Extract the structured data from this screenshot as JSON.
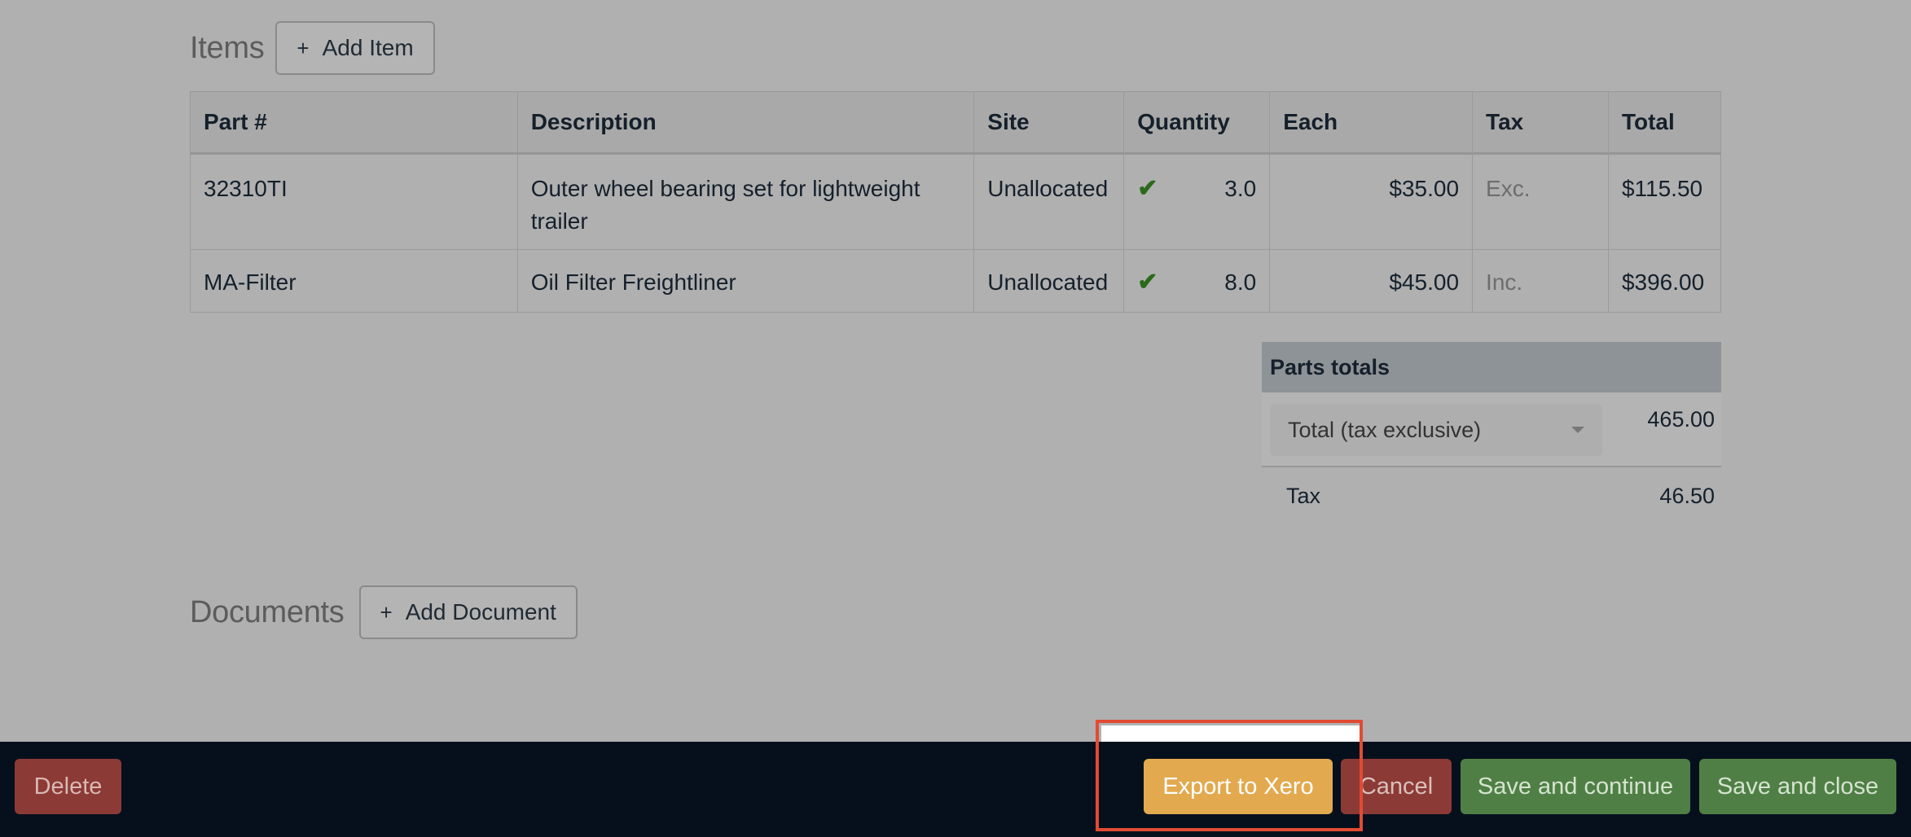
{
  "items_section": {
    "title": "Items",
    "add_button": "Add Item",
    "plus_glyph": "+"
  },
  "items_table": {
    "headers": [
      "Part #",
      "Description",
      "Site",
      "Quantity",
      "Each",
      "Tax",
      "Total"
    ],
    "rows": [
      {
        "part": "32310TI",
        "description": "Outer wheel bearing set for lightweight trailer",
        "site": "Unallocated",
        "allocated_check": "✔",
        "quantity": "3.0",
        "each": "$35.00",
        "tax": "Exc.",
        "total": "$115.50"
      },
      {
        "part": "MA-Filter",
        "description": "Oil Filter Freightliner",
        "site": "Unallocated",
        "allocated_check": "✔",
        "quantity": "8.0",
        "each": "$45.00",
        "tax": "Inc.",
        "total": "$396.00"
      }
    ]
  },
  "parts_totals": {
    "title": "Parts totals",
    "total_mode_selected": "Total (tax exclusive)",
    "total_value": "465.00",
    "tax_label": "Tax",
    "tax_value": "46.50"
  },
  "documents_section": {
    "title": "Documents",
    "add_button": "Add Document",
    "plus_glyph": "+"
  },
  "footer": {
    "delete": "Delete",
    "export": "Export to Xero",
    "cancel": "Cancel",
    "save_continue": "Save and continue",
    "save_close": "Save and close"
  },
  "colors": {
    "overlay_gray": "#b0b0b0",
    "footer_bg": "#06101d",
    "danger": "#8c3a36",
    "warning": "#e3a94f",
    "success": "#4f7f45",
    "highlight_border": "#e14b33",
    "check_green": "#2c6a1a"
  }
}
